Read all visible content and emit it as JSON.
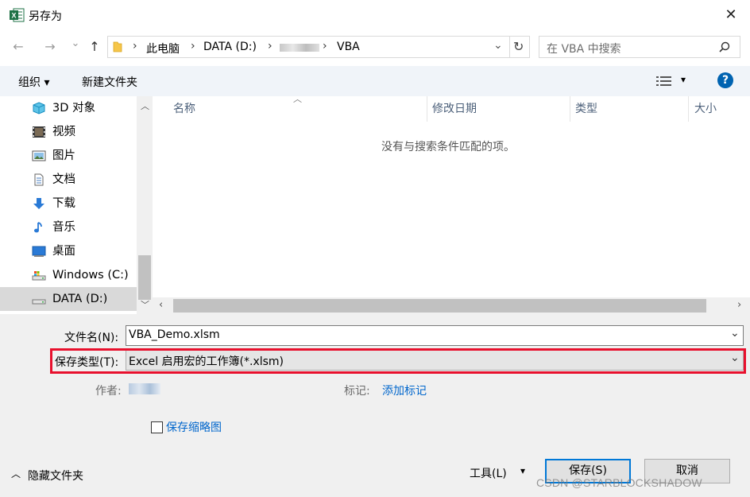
{
  "window": {
    "title": "另存为",
    "close_glyph": "✕"
  },
  "nav": {
    "back": "←",
    "forward": "→",
    "dropdown": "⌄",
    "up": "↑",
    "breadcrumb": [
      "此电脑",
      "DATA (D:)",
      "VBA"
    ],
    "separator": "›",
    "refresh": "↻",
    "search_placeholder": "在 VBA 中搜索"
  },
  "toolbar": {
    "organize": "组织 ▾",
    "new_folder": "新建文件夹",
    "view_dropdown": "▾",
    "help": "?"
  },
  "sidebar": {
    "items": [
      {
        "label": "3D 对象",
        "icon": "3d-objects-icon"
      },
      {
        "label": "视频",
        "icon": "video-icon"
      },
      {
        "label": "图片",
        "icon": "pictures-icon"
      },
      {
        "label": "文档",
        "icon": "documents-icon"
      },
      {
        "label": "下载",
        "icon": "downloads-icon"
      },
      {
        "label": "音乐",
        "icon": "music-icon"
      },
      {
        "label": "桌面",
        "icon": "desktop-icon"
      },
      {
        "label": "Windows (C:)",
        "icon": "drive-icon"
      },
      {
        "label": "DATA (D:)",
        "icon": "drive-icon"
      }
    ]
  },
  "file_list": {
    "columns": [
      "名称",
      "修改日期",
      "类型",
      "大小"
    ],
    "empty_message": "没有与搜索条件匹配的项。"
  },
  "form": {
    "filename_label": "文件名(N):",
    "filename_value": "VBA_Demo.xlsm",
    "filetype_label": "保存类型(T):",
    "filetype_value": "Excel 启用宏的工作簿(*.xlsm)",
    "author_label": "作者:",
    "tags_label": "标记:",
    "tags_link": "添加标记",
    "thumbnail_label": "保存缩略图"
  },
  "footer": {
    "hide_folders": "隐藏文件夹",
    "tools": "工具(L)",
    "save": "保存(S)",
    "cancel": "取消",
    "watermark": "CSDN @STARBLOCKSHADOW"
  },
  "colors": {
    "accent": "#0078d7",
    "highlight": "#e8102d",
    "toolbar_bg": "#f0f4f9",
    "excel_green": "#1e7145"
  }
}
